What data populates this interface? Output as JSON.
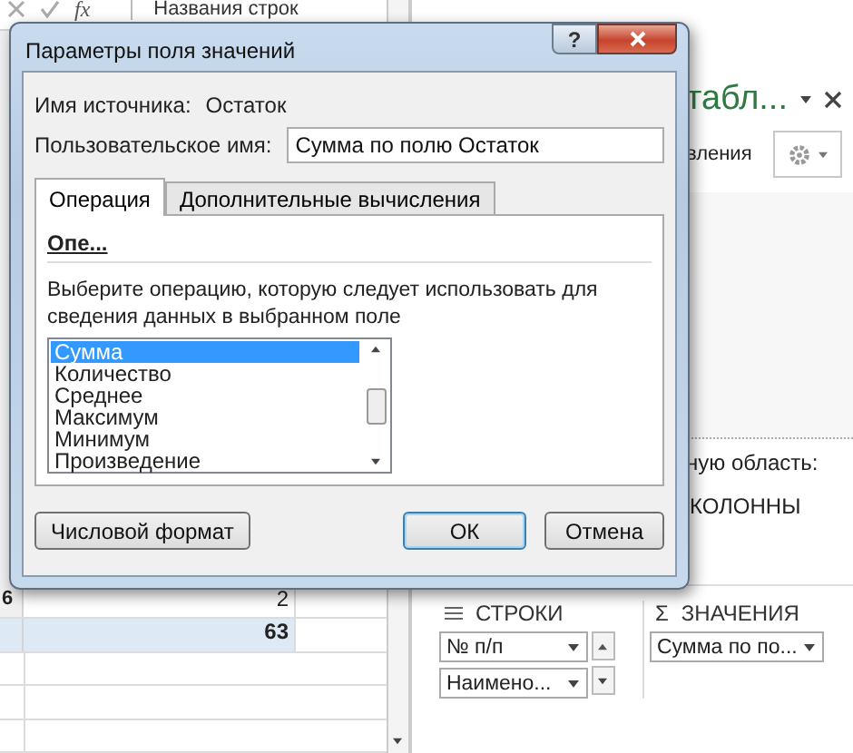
{
  "formula_bar": {
    "function_label": "fx",
    "text": "Названия строк"
  },
  "sheet": {
    "rows": [
      {
        "kind": "data",
        "header": "6",
        "value": "2"
      },
      {
        "kind": "total",
        "header": "",
        "value": "63"
      },
      {
        "kind": "empty"
      },
      {
        "kind": "empty"
      },
      {
        "kind": "empty"
      }
    ]
  },
  "pivot_panel": {
    "title": "табл...",
    "subtitle": "вления",
    "area_hint": "ную область:",
    "columns_label": "КОЛОННЫ",
    "rows_label": "СТРОКИ",
    "values_icon": "Σ",
    "values_label": "ЗНАЧЕНИЯ",
    "row_fields": [
      "№ п/п",
      "Наимено..."
    ],
    "value_fields": [
      "Сумма по по..."
    ]
  },
  "dialog": {
    "title": "Параметры поля значений",
    "help": "?",
    "source_label": "Имя источника:",
    "source_value": "Остаток",
    "custom_name_label": "Пользовательское имя:",
    "custom_name_value": "Сумма по полю Остаток",
    "tabs": [
      {
        "label": "Операция",
        "selected": true
      },
      {
        "label": "Дополнительные вычисления",
        "selected": false
      }
    ],
    "section_title": "Опе...",
    "description": "Выберите операцию, которую следует использовать для сведения данных в выбранном поле",
    "operations": [
      {
        "label": "Сумма",
        "selected": true
      },
      {
        "label": "Количество",
        "selected": false
      },
      {
        "label": "Среднее",
        "selected": false
      },
      {
        "label": "Максимум",
        "selected": false
      },
      {
        "label": "Минимум",
        "selected": false
      },
      {
        "label": "Произведение",
        "selected": false
      }
    ],
    "buttons": [
      {
        "kind": "secondary",
        "label": "Числовой формат"
      },
      {
        "kind": "default",
        "label": "ОК"
      },
      {
        "kind": "cancel",
        "label": "Отмена"
      }
    ]
  }
}
